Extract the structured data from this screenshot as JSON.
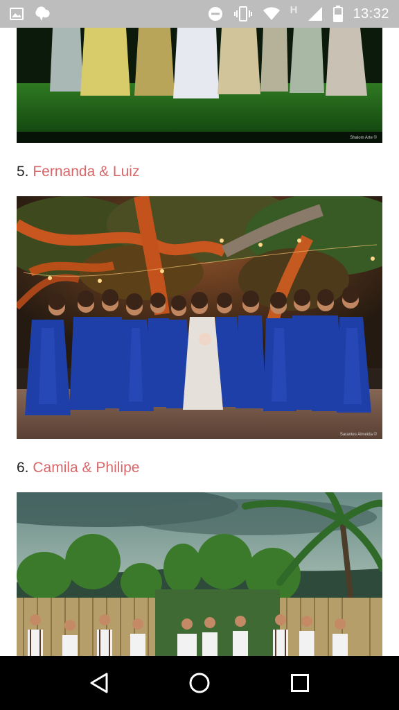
{
  "status_bar": {
    "time": "13:32",
    "network_label": "H",
    "icons": [
      "image-icon",
      "app-notification-icon",
      "do-not-disturb-icon",
      "vibrate-icon",
      "wifi-icon",
      "signal-icon",
      "battery-icon"
    ]
  },
  "entries": [
    {
      "number": "5.",
      "names": "Fernanda & Luiz"
    },
    {
      "number": "6.",
      "names": "Camila & Philipe"
    }
  ],
  "photo_credits": [
    "Shalom Arte ©",
    "Sarantes Almeida ©"
  ],
  "nav_bar": {
    "buttons": [
      "back-button",
      "home-button",
      "recents-button"
    ]
  },
  "colors": {
    "link": "#d8676a",
    "status_bar": "#bdbdbd",
    "nav_bar": "#000000",
    "dress_blue": "#1f3fa8"
  }
}
